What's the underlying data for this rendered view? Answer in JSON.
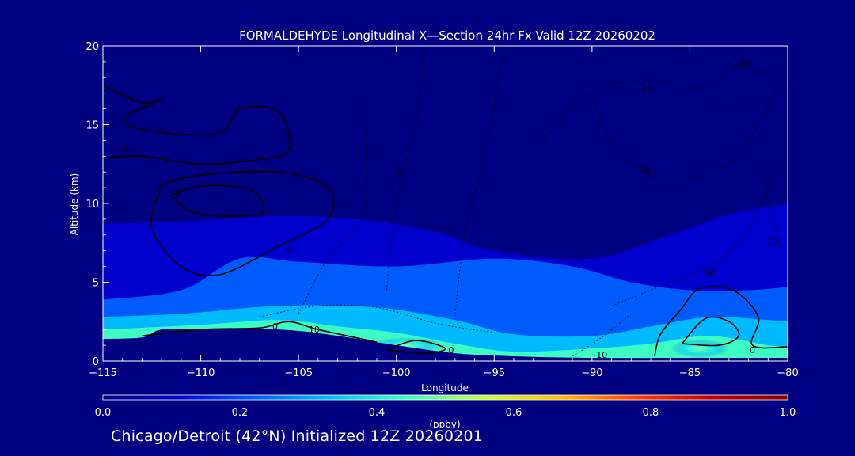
{
  "chart_data": {
    "type": "heatmap",
    "title": "FORMALDEHYDE Longitudinal X—Section 24hr  Fx Valid 12Z 20260202",
    "xlabel": "Longitude",
    "ylabel": "Altitude (km)",
    "xlim": [
      -115,
      -80
    ],
    "ylim": [
      0,
      20
    ],
    "x_ticks": [
      -115,
      -110,
      -105,
      -100,
      -95,
      -90,
      -85,
      -80
    ],
    "x_tick_labels": [
      "−115",
      "−110",
      "−105",
      "−100",
      "−95",
      "−90",
      "−85",
      "−80"
    ],
    "y_ticks": [
      0,
      5,
      10,
      15,
      20
    ],
    "y_tick_labels": [
      "0",
      "5",
      "10",
      "15",
      "20"
    ],
    "background_color": "#000080",
    "colorbar": {
      "label": "(ppbv)",
      "min": 0.0,
      "max": 1.0,
      "ticks": [
        0.0,
        0.2,
        0.4,
        0.6,
        0.8,
        1.0
      ],
      "tick_labels": [
        "0.0",
        "0.2",
        "0.4",
        "0.6",
        "0.8",
        "1.0"
      ],
      "colors": [
        "#000080",
        "#0000d0",
        "#0060ff",
        "#00c0ff",
        "#40ffc0",
        "#c0ff40",
        "#ffc000",
        "#ff4000",
        "#c00000",
        "#800000"
      ]
    },
    "terrain_top_km": [
      {
        "x": -115,
        "y": 1.4
      },
      {
        "x": -113,
        "y": 1.5
      },
      {
        "x": -112,
        "y": 2.0
      },
      {
        "x": -110,
        "y": 2.0
      },
      {
        "x": -106,
        "y": 2.0
      },
      {
        "x": -103,
        "y": 1.6
      },
      {
        "x": -100,
        "y": 1.0
      },
      {
        "x": -97,
        "y": 0.5
      },
      {
        "x": -94,
        "y": 0.3
      },
      {
        "x": -90,
        "y": 0.2
      },
      {
        "x": -86,
        "y": 0.2
      },
      {
        "x": -83,
        "y": 0.2
      },
      {
        "x": -80,
        "y": 0.2
      }
    ],
    "field_bands": [
      {
        "value": 0.05,
        "top": [
          {
            "x": -115,
            "y": 11.0
          },
          {
            "x": -110,
            "y": 11.3
          },
          {
            "x": -105,
            "y": 11.3
          },
          {
            "x": -100,
            "y": 11.5
          },
          {
            "x": -95,
            "y": 11.3
          },
          {
            "x": -90,
            "y": 11.0
          },
          {
            "x": -85,
            "y": 10.5
          },
          {
            "x": -80,
            "y": 10.6
          }
        ]
      },
      {
        "value": 0.12,
        "top": [
          {
            "x": -115,
            "y": 8.7
          },
          {
            "x": -110,
            "y": 8.9
          },
          {
            "x": -106,
            "y": 9.2
          },
          {
            "x": -102,
            "y": 9.0
          },
          {
            "x": -98,
            "y": 8.2
          },
          {
            "x": -95,
            "y": 7.0
          },
          {
            "x": -90,
            "y": 6.5
          },
          {
            "x": -86,
            "y": 8.0
          },
          {
            "x": -83,
            "y": 9.3
          },
          {
            "x": -80,
            "y": 10.0
          }
        ]
      },
      {
        "value": 0.2,
        "top": [
          {
            "x": -115,
            "y": 3.9
          },
          {
            "x": -111,
            "y": 4.5
          },
          {
            "x": -108,
            "y": 6.5
          },
          {
            "x": -105,
            "y": 6.3
          },
          {
            "x": -100,
            "y": 6.0
          },
          {
            "x": -95,
            "y": 6.5
          },
          {
            "x": -91,
            "y": 6.0
          },
          {
            "x": -88,
            "y": 5.0
          },
          {
            "x": -85,
            "y": 4.5
          },
          {
            "x": -82,
            "y": 4.5
          },
          {
            "x": -80,
            "y": 4.7
          }
        ]
      },
      {
        "value": 0.3,
        "top": [
          {
            "x": -115,
            "y": 2.8
          },
          {
            "x": -111,
            "y": 3.0
          },
          {
            "x": -106,
            "y": 3.5
          },
          {
            "x": -101,
            "y": 3.4
          },
          {
            "x": -97,
            "y": 2.6
          },
          {
            "x": -94,
            "y": 1.7
          },
          {
            "x": -90,
            "y": 1.6
          },
          {
            "x": -87,
            "y": 2.2
          },
          {
            "x": -84,
            "y": 2.8
          },
          {
            "x": -81,
            "y": 2.6
          },
          {
            "x": -80,
            "y": 2.5
          }
        ]
      },
      {
        "value": 0.4,
        "top": [
          {
            "x": -115,
            "y": 2.0
          },
          {
            "x": -110,
            "y": 2.3
          },
          {
            "x": -106,
            "y": 2.6
          },
          {
            "x": -103,
            "y": 2.2
          },
          {
            "x": -100,
            "y": 1.8
          },
          {
            "x": -97,
            "y": 1.1
          },
          {
            "x": -94,
            "y": 0.6
          },
          {
            "x": -90,
            "y": 0.8
          },
          {
            "x": -87,
            "y": 1.1
          },
          {
            "x": -84,
            "y": 1.6
          },
          {
            "x": -81,
            "y": 1.0
          },
          {
            "x": -80,
            "y": 0.9
          }
        ]
      }
    ],
    "hotspots": [
      {
        "x": -99.5,
        "y": 1.0,
        "rx": 1.8,
        "ry": 0.5,
        "value": 0.5
      },
      {
        "x": -84.5,
        "y": 0.8,
        "rx": 1.5,
        "ry": 0.6,
        "value": 0.45
      }
    ],
    "solid_contours": [
      {
        "label": "0",
        "label_at": {
          "x": -113.8,
          "y": 13.5
        },
        "points": [
          {
            "x": -115,
            "y": 17.5
          },
          {
            "x": -113,
            "y": 16.4
          },
          {
            "x": -112,
            "y": 16.6
          },
          {
            "x": -114,
            "y": 15.3
          },
          {
            "x": -112,
            "y": 14.5
          },
          {
            "x": -109,
            "y": 14.5
          },
          {
            "x": -108,
            "y": 16.0
          },
          {
            "x": -106,
            "y": 15.8
          },
          {
            "x": -105.5,
            "y": 13.4
          },
          {
            "x": -107,
            "y": 12.8
          },
          {
            "x": -110,
            "y": 12.5
          },
          {
            "x": -113,
            "y": 13.0
          },
          {
            "x": -115,
            "y": 12.9
          }
        ]
      },
      {
        "label": "0",
        "label_at": {
          "x": -105.5,
          "y": 7.0
        },
        "points": [
          {
            "x": -112,
            "y": 11.2
          },
          {
            "x": -110,
            "y": 11.8
          },
          {
            "x": -106,
            "y": 12.0
          },
          {
            "x": -103.5,
            "y": 11.0
          },
          {
            "x": -103.5,
            "y": 9.0
          },
          {
            "x": -106,
            "y": 7.3
          },
          {
            "x": -109,
            "y": 5.5
          },
          {
            "x": -111,
            "y": 6.0
          },
          {
            "x": -112.5,
            "y": 8.5
          },
          {
            "x": -112,
            "y": 11.2
          }
        ]
      },
      {
        "label": "10",
        "label_at": {
          "x": -111.3,
          "y": 10.7
        },
        "points": [
          {
            "x": -111.5,
            "y": 10.5
          },
          {
            "x": -110,
            "y": 11.1
          },
          {
            "x": -107.5,
            "y": 10.9
          },
          {
            "x": -106.8,
            "y": 9.5
          },
          {
            "x": -108.5,
            "y": 9.2
          },
          {
            "x": -110.5,
            "y": 9.5
          },
          {
            "x": -111.5,
            "y": 10.5
          }
        ]
      },
      {
        "label": "0",
        "label_at": {
          "x": -106.2,
          "y": 2.2
        },
        "points": [
          {
            "x": -113,
            "y": 1.6
          },
          {
            "x": -110,
            "y": 2.0
          },
          {
            "x": -107,
            "y": 2.1
          },
          {
            "x": -105.5,
            "y": 2.5
          },
          {
            "x": -104,
            "y": 2.0
          },
          {
            "x": -101,
            "y": 1.2
          }
        ]
      },
      {
        "label": "0",
        "label_at": {
          "x": -97.2,
          "y": 0.7
        },
        "points": [
          {
            "x": -100.5,
            "y": 0.7
          },
          {
            "x": -99,
            "y": 1.3
          },
          {
            "x": -97.5,
            "y": 0.8
          },
          {
            "x": -98.5,
            "y": 0.5
          },
          {
            "x": -100.5,
            "y": 0.7
          }
        ]
      },
      {
        "label": "0",
        "label_at": {
          "x": -81.8,
          "y": 0.7
        },
        "points": [
          {
            "x": -86.8,
            "y": 0.3
          },
          {
            "x": -86.5,
            "y": 1.7
          },
          {
            "x": -85.5,
            "y": 3.2
          },
          {
            "x": -84.5,
            "y": 4.6
          },
          {
            "x": -82.8,
            "y": 4.5
          },
          {
            "x": -81.5,
            "y": 2.8
          },
          {
            "x": -81.8,
            "y": 1.0
          },
          {
            "x": -80,
            "y": 0.9
          }
        ]
      },
      {
        "label": "",
        "label_at": {
          "x": -84,
          "y": 2
        },
        "points": [
          {
            "x": -85.4,
            "y": 1.1
          },
          {
            "x": -84.2,
            "y": 2.7
          },
          {
            "x": -83,
            "y": 2.5
          },
          {
            "x": -82.5,
            "y": 1.6
          },
          {
            "x": -83.5,
            "y": 1.0
          },
          {
            "x": -85.4,
            "y": 1.1
          }
        ]
      }
    ],
    "dashed_contours": [
      {
        "label": "10",
        "label_at": {
          "x": -104.2,
          "y": 2.0
        },
        "points": [
          {
            "x": -107,
            "y": 2.8
          },
          {
            "x": -104,
            "y": 3.5
          },
          {
            "x": -101,
            "y": 3.4
          },
          {
            "x": -98,
            "y": 2.4
          },
          {
            "x": -95,
            "y": 1.8
          }
        ]
      },
      {
        "label": "10",
        "label_at": {
          "x": -99.8,
          "y": 12.0
        },
        "points": [
          {
            "x": -100.5,
            "y": 4.5
          },
          {
            "x": -100,
            "y": 10.0
          },
          {
            "x": -99,
            "y": 15.0
          },
          {
            "x": -98.5,
            "y": 20.0
          }
        ]
      },
      {
        "label": "10",
        "label_at": {
          "x": -89.5,
          "y": 0.4
        },
        "points": [
          {
            "x": -91,
            "y": 0.3
          },
          {
            "x": -89.5,
            "y": 1.5
          },
          {
            "x": -88,
            "y": 3.0
          }
        ]
      },
      {
        "label": "20",
        "label_at": {
          "x": -84,
          "y": 5.6
        },
        "points": [
          {
            "x": -89,
            "y": 3.5
          },
          {
            "x": -86,
            "y": 5.0
          },
          {
            "x": -84,
            "y": 6.0
          },
          {
            "x": -82.5,
            "y": 7.5
          },
          {
            "x": -81.5,
            "y": 9.5
          },
          {
            "x": -80.5,
            "y": 12.0
          }
        ]
      },
      {
        "label": "30",
        "label_at": {
          "x": -87.3,
          "y": 12.1
        },
        "points": [
          {
            "x": -90,
            "y": 16.5
          },
          {
            "x": -88.5,
            "y": 13.0
          },
          {
            "x": -86,
            "y": 11.5
          },
          {
            "x": -83,
            "y": 12.5
          },
          {
            "x": -81.5,
            "y": 15.0
          },
          {
            "x": -80.5,
            "y": 17.5
          }
        ]
      },
      {
        "label": "10",
        "label_at": {
          "x": -82.2,
          "y": 18.9
        },
        "points": [
          {
            "x": -86,
            "y": 20.0
          },
          {
            "x": -83.5,
            "y": 19.0
          },
          {
            "x": -81.5,
            "y": 18.5
          },
          {
            "x": -80,
            "y": 17.5
          }
        ]
      },
      {
        "label": "10",
        "label_at": {
          "x": -80.8,
          "y": 7.6
        },
        "points": [
          {
            "x": -81.3,
            "y": 12.0
          },
          {
            "x": -80.8,
            "y": 9.5
          },
          {
            "x": -80.4,
            "y": 7.0
          }
        ]
      },
      {
        "label": "30",
        "label_at": {
          "x": -87.2,
          "y": 17.3
        },
        "points": [
          {
            "x": -92.5,
            "y": 14.0
          },
          {
            "x": -90,
            "y": 17.0
          },
          {
            "x": -87,
            "y": 17.8
          },
          {
            "x": -84,
            "y": 17.0
          },
          {
            "x": -82,
            "y": 16.0
          }
        ]
      },
      {
        "label": "",
        "label_at": {
          "x": -96,
          "y": 14
        },
        "points": [
          {
            "x": -97,
            "y": 3.0
          },
          {
            "x": -96.5,
            "y": 8.0
          },
          {
            "x": -95.5,
            "y": 13.0
          },
          {
            "x": -94.5,
            "y": 20.0
          }
        ]
      },
      {
        "label": "",
        "label_at": {
          "x": -103,
          "y": 7
        },
        "points": [
          {
            "x": -105,
            "y": 3.0
          },
          {
            "x": -103.5,
            "y": 6.5
          },
          {
            "x": -102,
            "y": 8.5
          },
          {
            "x": -101.5,
            "y": 11.0
          },
          {
            "x": -101.5,
            "y": 16.0
          }
        ]
      }
    ]
  },
  "footer": {
    "label": "Chicago/Detroit (42°N) Initialized 12Z 20260201"
  }
}
